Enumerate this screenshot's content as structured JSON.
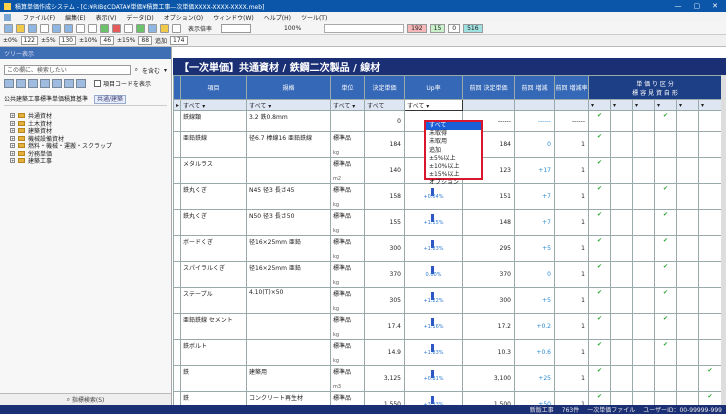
{
  "window": {
    "title": "積算単価作成システム - [C:¥RIB¢CDATA¥単価¥積算工事—次単価XXXX-XXXX-XXXX.meb]"
  },
  "menu": [
    "ファイル(F)",
    "編集(E)",
    "表示(V)",
    "データ(D)",
    "オプション(O)",
    "ウィンドウ(W)",
    "ヘルプ(H)",
    "ツール(T)"
  ],
  "toolbar": {
    "view_label": "表示倍率",
    "pct": "100%",
    "counts": [
      "192",
      "15",
      "0",
      "516"
    ]
  },
  "filterbar": [
    {
      "label": "±0%",
      "value": "122"
    },
    {
      "label": "±5%",
      "value": "130"
    },
    {
      "label": "±10%",
      "value": "46"
    },
    {
      "label": "±15%",
      "value": "88"
    },
    {
      "label": "追加",
      "value": "174"
    }
  ],
  "sidebar": {
    "header": "ツリー表示",
    "search_placeholder": "この欄に、検索したい",
    "search_mode": "を含む",
    "checkbox_label": "項目コードを表示",
    "section": "公共建築工事標準単価積算基準",
    "section_tag": "共通/建築",
    "tree": [
      "共通資材",
      "土木資材",
      "建築資材",
      "機械設備資材",
      "燃料・機械・運搬・スクラップ",
      "労務単価",
      "建築工事"
    ],
    "footer": "指標検索(S)"
  },
  "main": {
    "title": "【一次単価】共通資材 / 鉄鋼二次製品 / 線材",
    "columns": [
      "項目",
      "規格",
      "単位",
      "決定単価",
      "Up率",
      "前回\n決定単価",
      "前回\n増減",
      "前回\n増減率",
      "単 価 り 区 分"
    ],
    "region_cols": [
      "標",
      "容",
      "見",
      "資",
      "自",
      "形"
    ],
    "filter_row": [
      "すべて",
      "すべて",
      "すべて",
      "すべて",
      "すべて",
      "すべて"
    ],
    "rows": [
      {
        "item": "鉄線類",
        "spec": "3.2 鉄0.8mm",
        "unit": "",
        "price": "0",
        "up": "",
        "prev": "------",
        "diff": "------",
        "rate": "------",
        "checks": [
          1,
          0,
          0,
          1,
          0,
          0
        ]
      },
      {
        "item": "亜鉛鉄線",
        "spec": "径6.7 棒線16 亜鉛鉄線",
        "unit": "kg",
        "type": "標準品",
        "price": "184",
        "up": "",
        "prev": "184",
        "diff": "0",
        "rate": "1",
        "checks": [
          1,
          0,
          0,
          0,
          0,
          0
        ]
      },
      {
        "item": "メタルラス",
        "spec": "",
        "unit": "m2",
        "type": "標準品",
        "price": "140",
        "up": "+1.81%",
        "prev": "123",
        "diff": "+17",
        "rate": "1",
        "checks": [
          1,
          0,
          0,
          0,
          0,
          0
        ]
      },
      {
        "item": "鉄丸くぎ",
        "spec": "N45 径3 長さ45",
        "unit": "kg",
        "type": "標準品",
        "price": "158",
        "up": "+0.04%",
        "prev": "151",
        "diff": "+7",
        "rate": "1",
        "checks": [
          1,
          0,
          0,
          1,
          0,
          0
        ]
      },
      {
        "item": "鉄丸くぎ",
        "spec": "N50 径3 長さ50",
        "unit": "kg",
        "type": "標準品",
        "price": "155",
        "up": "+1.15%",
        "prev": "148",
        "diff": "+7",
        "rate": "1",
        "checks": [
          1,
          0,
          0,
          1,
          0,
          0
        ]
      },
      {
        "item": "ボードくぎ",
        "spec": "径16×25mm 亜鉛",
        "unit": "kg",
        "type": "標準品",
        "price": "300",
        "up": "+1.83%",
        "prev": "295",
        "diff": "+5",
        "rate": "1",
        "checks": [
          1,
          0,
          0,
          1,
          0,
          0
        ]
      },
      {
        "item": "スパイラルくぎ",
        "spec": "径16×25mm 亜鉛",
        "unit": "kg",
        "type": "標準品",
        "price": "370",
        "up": "0.00%",
        "prev": "370",
        "diff": "0",
        "rate": "1",
        "checks": [
          1,
          0,
          0,
          1,
          0,
          0
        ]
      },
      {
        "item": "ステープル",
        "spec": "4.10(T)×50",
        "unit": "kg",
        "type": "標準品",
        "price": "305",
        "up": "+1.22%",
        "prev": "300",
        "diff": "+5",
        "rate": "1",
        "checks": [
          1,
          0,
          0,
          1,
          0,
          0
        ]
      },
      {
        "item": "亜鉛鉄線 セメント",
        "spec": "",
        "unit": "kg",
        "type": "標準品",
        "price": "17.4",
        "up": "+1.16%",
        "prev": "17.2",
        "diff": "+0.2",
        "rate": "1",
        "checks": [
          1,
          0,
          0,
          1,
          0,
          0
        ]
      },
      {
        "item": "鉄ボルト",
        "spec": "",
        "unit": "kg",
        "type": "標準品",
        "price": "14.9",
        "up": "+1.83%",
        "prev": "10.3",
        "diff": "+0.6",
        "rate": "1",
        "checks": [
          1,
          0,
          0,
          1,
          0,
          0
        ]
      },
      {
        "item": "鉄",
        "spec": "建築用",
        "unit": "m3",
        "type": "標準品",
        "price": "3,125",
        "up": "+0.81%",
        "prev": "3,100",
        "diff": "+25",
        "rate": "1",
        "checks": [
          1,
          0,
          0,
          0,
          0,
          1
        ]
      },
      {
        "item": "鉄",
        "spec": "コンクリート再生材",
        "unit": "m3",
        "type": "標準品",
        "price": "1,550",
        "up": "+3.33%",
        "prev": "1,500",
        "diff": "+50",
        "rate": "1",
        "checks": [
          1,
          0,
          0,
          0,
          0,
          1
        ]
      }
    ]
  },
  "dropdown": {
    "options": [
      "すべて",
      "未取得",
      "未取用",
      "追加",
      "±5%以上",
      "±10%以上",
      "±15%以上",
      "オプション"
    ],
    "selected": 0
  },
  "status": {
    "left": "新版工事",
    "count": "763件",
    "file": "一次単価ファイル",
    "user": "ユーザーID：00-99999-999"
  }
}
